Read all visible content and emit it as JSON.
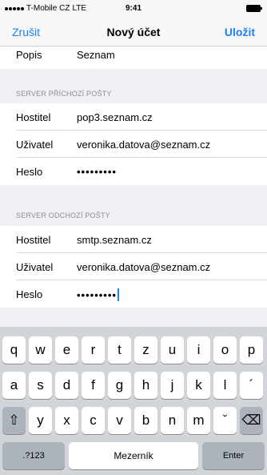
{
  "status_bar": {
    "carrier": "T-Mobile CZ",
    "network": "LTE",
    "time": "9:41"
  },
  "nav": {
    "cancel_label": "Zrušit",
    "title": "Nový účet",
    "save_label": "Uložit"
  },
  "top_row": {
    "label": "Popis",
    "value": "Seznam"
  },
  "incoming": {
    "header": "SERVER PŘÍCHOZÍ POŠTY",
    "host_label": "Hostitel",
    "host_value": "pop3.seznam.cz",
    "user_label": "Uživatel",
    "user_value": "veronika.datova@seznam.cz",
    "pass_label": "Heslo",
    "pass_value": "•••••••••"
  },
  "outgoing": {
    "header": "SERVER ODCHOZÍ POŠTY",
    "host_label": "Hostitel",
    "host_value": "smtp.seznam.cz",
    "user_label": "Uživatel",
    "user_value": "veronika.datova@seznam.cz",
    "pass_label": "Heslo",
    "pass_value": "•••••••••"
  },
  "keyboard": {
    "row1": [
      "q",
      "w",
      "e",
      "r",
      "t",
      "z",
      "u",
      "i",
      "o",
      "p"
    ],
    "row2": [
      "a",
      "s",
      "d",
      "f",
      "g",
      "h",
      "j",
      "k",
      "l",
      "´"
    ],
    "row3": [
      "y",
      "x",
      "c",
      "v",
      "b",
      "n",
      "m",
      "ˇ"
    ],
    "shift_glyph": "⇧",
    "backspace_glyph": "⌫",
    "numbers_label": ".?123",
    "space_label": "Mezerník",
    "enter_label": "Enter"
  }
}
